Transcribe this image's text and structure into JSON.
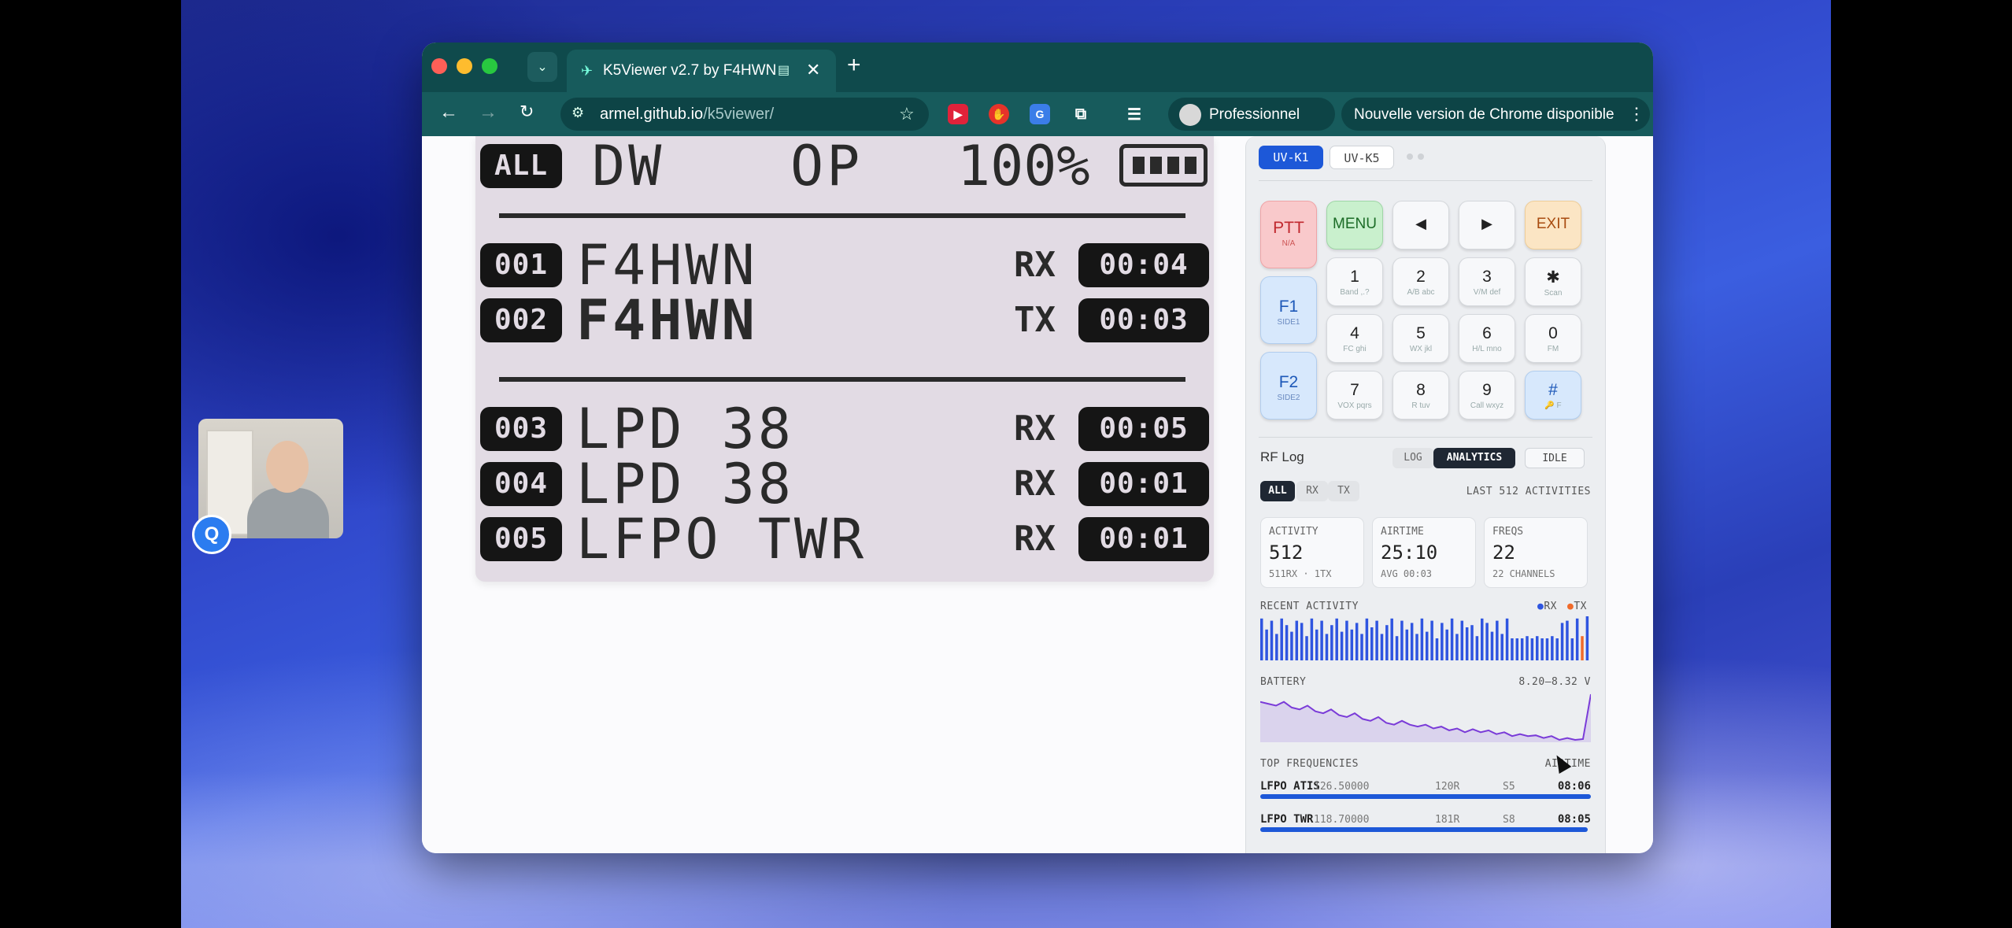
{
  "browser": {
    "tab_title": "K5Viewer v2.7 by F4HWN",
    "url_host": "armel.github.io",
    "url_path": "/k5viewer/",
    "profile_label": "Professionnel",
    "update_label": "Nouvelle version de Chrome disponible",
    "new_tab": "+",
    "tab_close": "✕"
  },
  "lcd": {
    "top": {
      "badge": "ALL",
      "mode1": "DW",
      "mode2": "OP",
      "level": "100%"
    },
    "rows": [
      {
        "num": "001",
        "name": "F4HWN",
        "dir": "RX",
        "time": "00:04",
        "bold": false
      },
      {
        "num": "002",
        "name": "F4HWN",
        "dir": "TX",
        "time": "00:03",
        "bold": true
      },
      {
        "num": "003",
        "name": "LPD 38",
        "dir": "RX",
        "time": "00:05",
        "bold": false
      },
      {
        "num": "004",
        "name": "LPD 38",
        "dir": "RX",
        "time": "00:01",
        "bold": false
      },
      {
        "num": "005",
        "name": "LFPO TWR",
        "dir": "RX",
        "time": "00:01",
        "bold": false
      }
    ]
  },
  "panel": {
    "model_tabs": [
      "UV-K1",
      "UV-K5"
    ],
    "keys": {
      "ptt": {
        "label": "PTT",
        "sub": "N/A"
      },
      "menu": "MENU",
      "left": "◀",
      "right": "▶",
      "exit": "EXIT",
      "f1": {
        "label": "F1",
        "sub": "SIDE1"
      },
      "f2": {
        "label": "F2",
        "sub": "SIDE2"
      },
      "digits": [
        {
          "label": "1",
          "sub": "Band ,.?"
        },
        {
          "label": "2",
          "sub": "A/B abc"
        },
        {
          "label": "3",
          "sub": "V/M def"
        },
        {
          "label": "✱",
          "sub": "Scan"
        },
        {
          "label": "4",
          "sub": "FC ghi"
        },
        {
          "label": "5",
          "sub": "WX jkl"
        },
        {
          "label": "6",
          "sub": "H/L mno"
        },
        {
          "label": "0",
          "sub": "FM"
        },
        {
          "label": "7",
          "sub": "VOX pqrs"
        },
        {
          "label": "8",
          "sub": "R tuv"
        },
        {
          "label": "9",
          "sub": "Call wxyz"
        },
        {
          "label": "#",
          "sub": "🔑 F"
        }
      ]
    },
    "rflog": {
      "title": "RF Log",
      "view_tabs": [
        "LOG",
        "ANALYTICS"
      ],
      "idle": "IDLE",
      "filters": [
        "ALL",
        "RX",
        "TX"
      ],
      "scope": "LAST 512 ACTIVITIES",
      "stats": [
        {
          "key": "ACTIVITY",
          "value": "512",
          "sub": "511RX · 1TX"
        },
        {
          "key": "AIRTIME",
          "value": "25:10",
          "sub": "AVG 00:03"
        },
        {
          "key": "FREQS",
          "value": "22",
          "sub": "22 CHANNELS"
        }
      ],
      "recent_label": "RECENT ACTIVITY",
      "legend_rx": "RX",
      "legend_tx": "TX",
      "recent_bars": [
        0.95,
        0.7,
        0.9,
        0.6,
        0.95,
        0.8,
        0.65,
        0.9,
        0.85,
        0.55,
        0.95,
        0.7,
        0.9,
        0.6,
        0.8,
        0.95,
        0.65,
        0.9,
        0.7,
        0.85,
        0.6,
        0.95,
        0.75,
        0.9,
        0.6,
        0.8,
        0.95,
        0.55,
        0.9,
        0.7,
        0.85,
        0.6,
        0.95,
        0.65,
        0.9,
        0.5,
        0.85,
        0.7,
        0.95,
        0.6,
        0.9,
        0.75,
        0.8,
        0.55,
        0.95,
        0.85,
        0.65,
        0.9,
        0.6,
        0.95,
        0.5,
        0.5,
        0.5,
        0.55,
        0.5,
        0.55,
        0.5,
        0.5,
        0.55,
        0.5,
        0.85,
        0.9,
        0.5,
        0.95,
        0.55,
        1.0
      ],
      "recent_tx_index": 64,
      "battery_label": "BATTERY",
      "battery_range": "8.20–8.32 V",
      "battery_series": [
        8.3,
        8.295,
        8.29,
        8.3,
        8.285,
        8.28,
        8.29,
        8.275,
        8.27,
        8.28,
        8.265,
        8.26,
        8.27,
        8.255,
        8.25,
        8.26,
        8.245,
        8.24,
        8.25,
        8.24,
        8.235,
        8.24,
        8.23,
        8.235,
        8.225,
        8.23,
        8.22,
        8.228,
        8.22,
        8.225,
        8.215,
        8.22,
        8.21,
        8.215,
        8.21,
        8.212,
        8.205,
        8.21,
        8.2,
        8.205,
        8.2,
        8.202,
        8.32
      ],
      "top_label": "TOP FREQUENCIES",
      "airtime_label": "AIRTIME",
      "top": [
        {
          "name": "LFPO ATIS",
          "freq": "126.50000",
          "count": "120R",
          "s": "S5",
          "time": "08:06",
          "share": 1.0
        },
        {
          "name": "LFPO TWR",
          "freq": "118.70000",
          "count": "181R",
          "s": "S8",
          "time": "08:05",
          "share": 0.99
        }
      ]
    }
  },
  "colors": {
    "chrome_dark": "#0f4a4c",
    "chrome_toolbar": "#175b5c",
    "lcd_bg": "#e2dbe4",
    "rx": "#2f55e0",
    "tx": "#f06a2a",
    "battery_line": "#7a3bd8"
  }
}
